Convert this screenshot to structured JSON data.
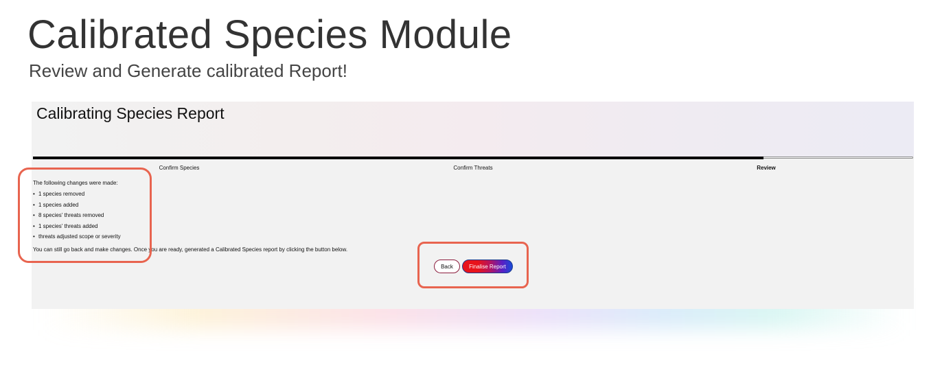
{
  "page": {
    "title": "Calibrated Species Module",
    "subtitle": "Review and Generate calibrated Report!"
  },
  "card": {
    "title": "Calibrating Species Report",
    "progress_fraction": 0.83
  },
  "steps": [
    {
      "label": "Confirm Species",
      "active": false
    },
    {
      "label": "Confirm Threats",
      "active": false
    },
    {
      "label": "Review",
      "active": true
    }
  ],
  "changes": {
    "heading": "The following changes were made:",
    "items": [
      "1 species removed",
      "1 species added",
      "8 species' threats removed",
      "1 species' threats added",
      "threats adjusted scope or severity"
    ]
  },
  "instruction": "You can still go back and make changes. Once you are ready, generated a Calibrated Species report by clicking the button below.",
  "buttons": {
    "back_label": "Back",
    "finalise_label": "Finalise Report"
  },
  "colors": {
    "highlight": "#e8644f",
    "progress": "#000000",
    "card_bg": "#f2f2f2",
    "finalise_gradient_start": "#e8131b",
    "finalise_gradient_end": "#1a4bd8"
  }
}
